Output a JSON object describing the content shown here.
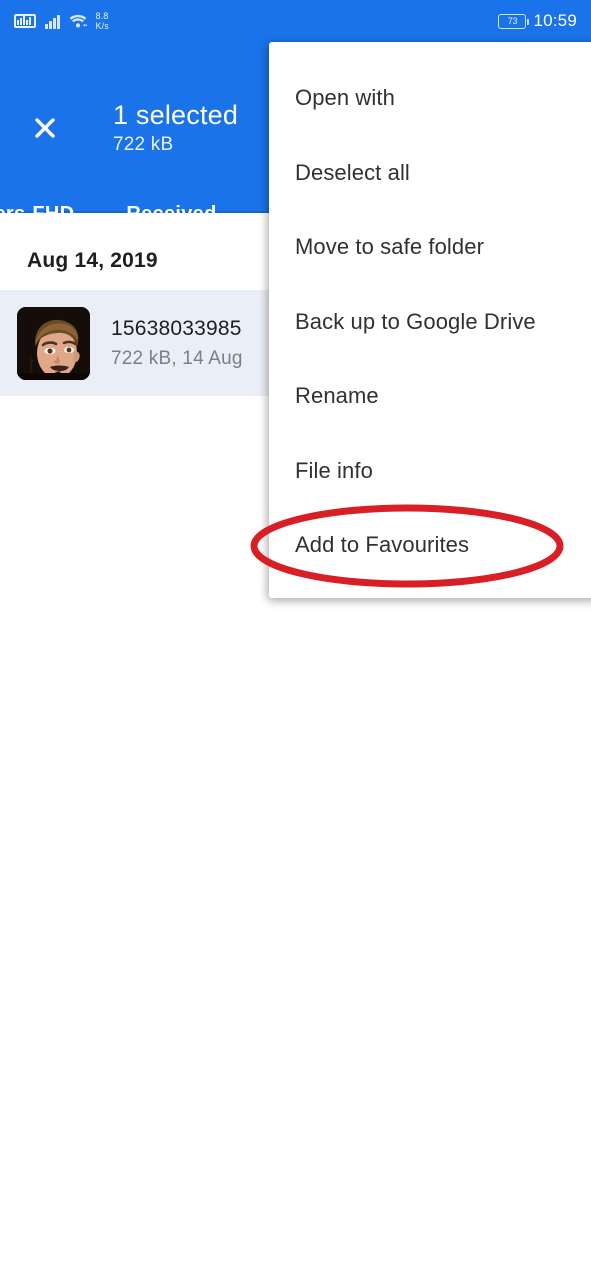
{
  "status_bar": {
    "network_speed": "8.8\nK/s",
    "network_speed_value": "8.8",
    "network_speed_unit": "K/s",
    "battery_percent": "73",
    "clock": "10:59",
    "icons": [
      "sim-card-icon",
      "signal-bars-icon",
      "wifi-icon",
      "battery-icon"
    ]
  },
  "app_bar": {
    "close_label": "close-icon",
    "selected_count_text": "1 selected",
    "selected_size_text": "722 kB",
    "background_color": "#1a73e8",
    "tabs": [
      {
        "label": "papers-FHD",
        "selected": false
      },
      {
        "label": "Received",
        "selected": true
      }
    ]
  },
  "content": {
    "date_header": "Aug 14, 2019",
    "files": [
      {
        "name": "15638033985",
        "meta": "722 kB, 14 Aug",
        "selected": true,
        "thumbnail": "portrait-thumbnail"
      }
    ]
  },
  "popup_menu": {
    "items": [
      {
        "label": "Open with"
      },
      {
        "label": "Deselect all"
      },
      {
        "label": "Move to safe folder"
      },
      {
        "label": "Back up to Google Drive"
      },
      {
        "label": "Rename"
      },
      {
        "label": "File info"
      },
      {
        "label": "Add to Favourites"
      }
    ]
  },
  "annotation": {
    "type": "ellipse-highlight",
    "color": "#d91f26",
    "target_label": "Add to Favourites"
  }
}
